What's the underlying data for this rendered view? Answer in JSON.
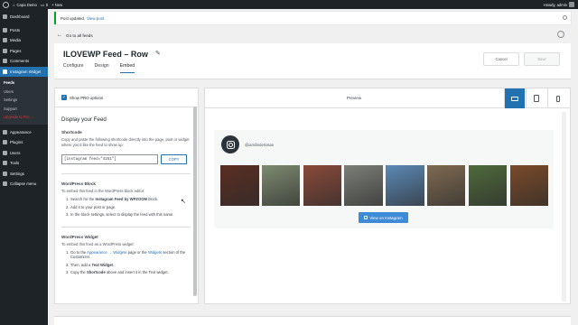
{
  "admin_bar": {
    "site_name": "Capa Demo",
    "comments_count": "0",
    "new_label": "+ New",
    "greeting": "Howdy, admin"
  },
  "sidebar": {
    "items_top": [
      {
        "label": "Dashboard",
        "icon": "dashboard-icon"
      },
      {
        "label": "Posts",
        "icon": "pin-icon"
      },
      {
        "label": "Media",
        "icon": "media-icon"
      },
      {
        "label": "Pages",
        "icon": "page-icon"
      },
      {
        "label": "Comments",
        "icon": "comment-icon"
      }
    ],
    "active": {
      "label": "Instagram Widget",
      "icon": "instagram-icon"
    },
    "submenu": [
      "Feeds",
      "Users",
      "Settings",
      "Support",
      "Upgrade to Pro →"
    ],
    "items_bottom": [
      {
        "label": "Appearance",
        "icon": "brush-icon"
      },
      {
        "label": "Plugins",
        "icon": "plugin-icon"
      },
      {
        "label": "Users",
        "icon": "users-icon"
      },
      {
        "label": "Tools",
        "icon": "wrench-icon"
      },
      {
        "label": "Settings",
        "icon": "settings-icon"
      },
      {
        "label": "Collapse menu",
        "icon": "collapse-icon"
      }
    ]
  },
  "notice": {
    "text": "Post updated.",
    "link": "View post"
  },
  "back_link": "Go to all feeds",
  "header": {
    "feed_title": "ILOVEWP Feed – Row",
    "tabs": [
      "Configure",
      "Design",
      "Embed"
    ],
    "active_tab": "Embed",
    "cancel_label": "Cancel",
    "save_label": "Save"
  },
  "embed_panel": {
    "show_pro_options": "Show PRO options",
    "section_title": "Display your Feed",
    "shortcode": {
      "heading": "Shortcode",
      "description": "Copy and paste the following shortcode directly into the page, post or widget where you'd like the feed to show up:",
      "value": "[instagram feed=\"4251\"]",
      "copy_label": "COPY"
    },
    "block": {
      "heading": "WordPress Block",
      "intro": "To embed this feed in the WordPress block editor:",
      "step1_pre": "Search for the",
      "step1_bold": "Instagram Feed by WPZOOM",
      "step1_post": "block.",
      "step2": "Add it to your post or page.",
      "step3": "In the block settings, select to display the feed with this name."
    },
    "widget": {
      "heading": "WordPress Widget",
      "intro": "To embed this feed as a WordPress widget:",
      "step1_pre": "Go to the",
      "step1_link1": "Appearance → Widgets",
      "step1_mid": "page or the",
      "step1_link2": "Widgets",
      "step1_post": "section of the Customizer.",
      "step2_pre": "Then, add a",
      "step2_bold": "Text Widget",
      "step2_post": ".",
      "step3_pre": "Copy the",
      "step3_bold": "Shortcode",
      "step3_post": "above and insert it in the Text widget."
    }
  },
  "preview": {
    "label": "Preview",
    "username": "@iamilinderiosan",
    "view_button": "View on Instagram",
    "photo_colors": [
      "#5a2e22",
      "#7d8a70",
      "#8a4a3a",
      "#7c7f78",
      "#5c89b6",
      "#7f6a52",
      "#4f6a3c",
      "#7a4a2a"
    ],
    "accent_color": "#2271b1"
  }
}
